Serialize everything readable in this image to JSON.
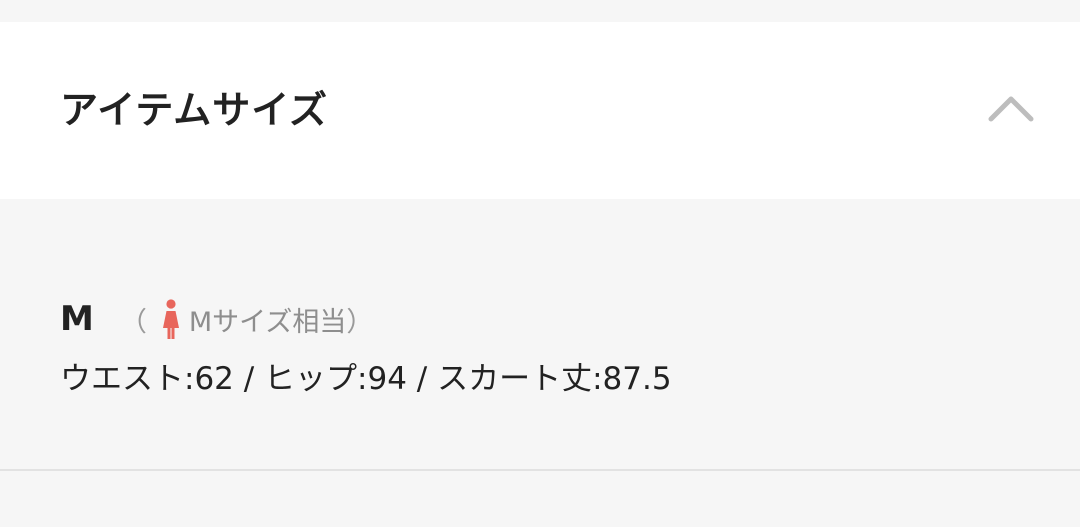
{
  "section": {
    "title": "アイテムサイズ",
    "expanded": true,
    "toggle_icon": "chevron-up-icon"
  },
  "size_entry": {
    "label": "M",
    "note_open": "（",
    "note_icon": "woman-figure-icon",
    "note_text": "Mサイズ相当",
    "note_close": "）",
    "measurements": "ウエスト:62 / ヒップ:94 / スカート丈:87.5"
  },
  "colors": {
    "header_bg": "#ffffff",
    "content_bg": "#f6f6f6",
    "text": "#222222",
    "muted_text": "#8e8e8e",
    "icon_accent": "#e8665c",
    "chevron": "#bdbdbd",
    "divider": "#e2e2e2"
  }
}
